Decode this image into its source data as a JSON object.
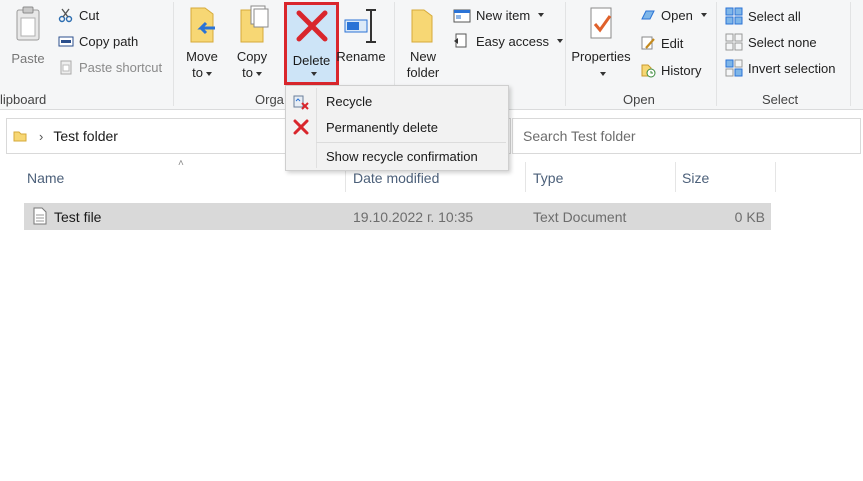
{
  "ribbon": {
    "clipboard": {
      "label": "lipboard",
      "paste": "Paste",
      "cut": "Cut",
      "copy_path": "Copy path",
      "paste_shortcut": "Paste shortcut"
    },
    "organize": {
      "label": "Orga",
      "move_to_line1": "Move",
      "move_to_line2": "to",
      "copy_to_line1": "Copy",
      "copy_to_line2": "to",
      "delete": "Delete",
      "rename": "Rename"
    },
    "new": {
      "new_folder_line1": "New",
      "new_folder_line2": "folder",
      "new_item": "New item",
      "easy_access": "Easy access"
    },
    "open": {
      "label": "Open",
      "properties": "Properties",
      "open": "Open",
      "edit": "Edit",
      "history": "History"
    },
    "select": {
      "label": "Select",
      "select_all": "Select all",
      "select_none": "Select none",
      "invert_selection": "Invert selection"
    }
  },
  "delete_menu": {
    "items": [
      {
        "label": "Recycle",
        "icon": "recycle-bin-icon"
      },
      {
        "label": "Permanently delete",
        "icon": "red-x-icon"
      },
      {
        "label": "Show recycle confirmation",
        "icon": ""
      }
    ]
  },
  "address_bar": {
    "path": "Test folder"
  },
  "search": {
    "placeholder": "Search Test folder"
  },
  "file_list": {
    "columns": [
      "Name",
      "Date modified",
      "Type",
      "Size"
    ],
    "rows": [
      {
        "name": "Test file",
        "date": "19.10.2022 г. 10:35",
        "type": "Text Document",
        "size": "0 KB"
      }
    ]
  },
  "colors": {
    "accent_red": "#d9262c",
    "selection": "#d9d9d9",
    "delete_highlight": "#cde4f7"
  }
}
